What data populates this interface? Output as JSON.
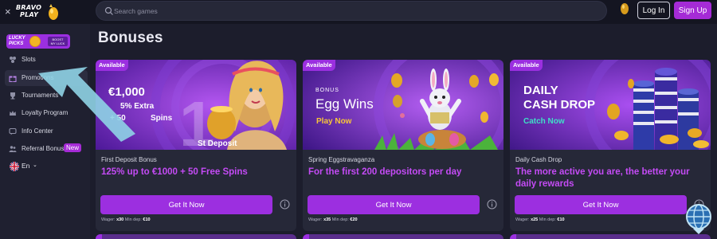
{
  "header": {
    "close_glyph": "×",
    "logo_text_line1": "BRAVO",
    "logo_text_line2": "PLAY",
    "search_placeholder": "Search games",
    "login_label": "Log In",
    "signup_label": "Sign Up"
  },
  "sidebar": {
    "lucky_picks": {
      "title_line1": "LUCKY",
      "title_line2": "PICKS",
      "badge_line1": "BOOST",
      "badge_line2": "MY LUCK"
    },
    "items": [
      {
        "label": "Slots",
        "icon": "slot-icon"
      },
      {
        "label": "Promotions",
        "icon": "gift-icon",
        "active": true
      },
      {
        "label": "Tournaments",
        "icon": "trophy-icon"
      },
      {
        "label": "Loyalty Program",
        "icon": "crown-icon"
      },
      {
        "label": "Info Center",
        "icon": "chat-icon"
      },
      {
        "label": "Referral Bonus",
        "icon": "users-icon",
        "badge": "New"
      }
    ],
    "language": {
      "label": "En",
      "chevron": "⌄"
    }
  },
  "main": {
    "title": "Bonuses",
    "cards": [
      {
        "badge": "Available",
        "banner_amount": "€1,000",
        "banner_line2": "5% Extra",
        "banner_line3": "+ 50",
        "banner_line3_end": "Spins",
        "banner_deposit": "St Deposit",
        "banner_big": "1",
        "name": "First Deposit Bonus",
        "description": "125% up to €1000 + 50 Free Spins",
        "button": "Get It Now",
        "wager_label": "Wager:",
        "wager": "x30",
        "min_dep_label": "Min dep:",
        "min_dep": "€10"
      },
      {
        "badge": "Available",
        "banner_small": "BONUS",
        "banner_title": "Egg Wins",
        "banner_cta": "Play Now",
        "name": "Spring Eggstravaganza",
        "description": "For the first 200 depositors per day",
        "button": "Get It Now",
        "wager_label": "Wager:",
        "wager": "x35",
        "min_dep_label": "Min dep:",
        "min_dep": "€20"
      },
      {
        "badge": "Available",
        "banner_title_1": "DAILY",
        "banner_title_2": "CASH DROP",
        "banner_cta": "Catch Now",
        "name": "Daily Cash Drop",
        "description": "The more active you are, the better your daily rewards",
        "button": "Get It Now",
        "wager_label": "Wager:",
        "wager": "x25",
        "min_dep_label": "Min dep:",
        "min_dep": "€10"
      }
    ]
  },
  "colors": {
    "background": "#1c1d2c",
    "sidebar": "#1f2030",
    "card": "#262838",
    "accent_purple": "#9c2fe0",
    "description_purple": "#c44bf5",
    "arrow_cyan": "#8fd3e6"
  }
}
